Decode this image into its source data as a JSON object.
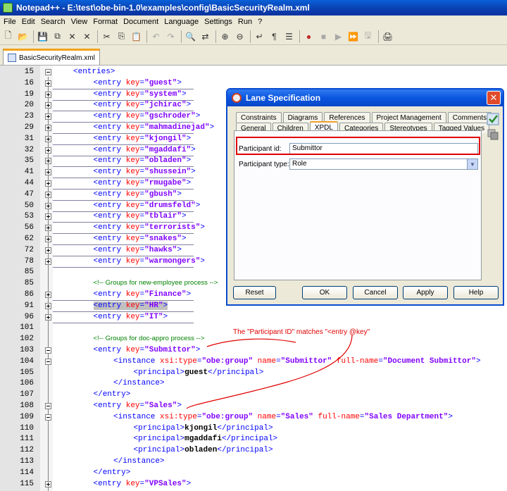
{
  "window": {
    "title": "Notepad++ - E:\\test\\obe-bin-1.0\\examples\\config\\BasicSecurityRealm.xml"
  },
  "menu": [
    "File",
    "Edit",
    "Search",
    "View",
    "Format",
    "Document",
    "Language",
    "Settings",
    "Run",
    "?"
  ],
  "toolbar": {
    "icons": [
      "new-file",
      "open-file",
      "save",
      "save-all",
      "close",
      "close-all",
      "cut",
      "copy",
      "paste",
      "undo",
      "redo",
      "find",
      "replace",
      "zoom-in",
      "zoom-out",
      "wrap",
      "show-all",
      "indent-guide",
      "record-macro",
      "stop-record",
      "play-macro",
      "run-macro-multiple",
      "save-macro",
      "print"
    ]
  },
  "tab": {
    "filename": "BasicSecurityRealm.xml"
  },
  "editor": {
    "lines": [
      {
        "n": "15",
        "kind": "open",
        "indent": 1,
        "text": "<entries>"
      },
      {
        "n": "16",
        "kind": "entry",
        "key": "guest"
      },
      {
        "n": "19",
        "kind": "entry",
        "key": "system"
      },
      {
        "n": "20",
        "kind": "entry",
        "key": "jchirac"
      },
      {
        "n": "23",
        "kind": "entry",
        "key": "gschroder"
      },
      {
        "n": "29",
        "kind": "entry",
        "key": "mahmadinejad"
      },
      {
        "n": "31",
        "kind": "entry",
        "key": "kjongil"
      },
      {
        "n": "32",
        "kind": "entry",
        "key": "mgaddafi"
      },
      {
        "n": "35",
        "kind": "entry",
        "key": "obladen"
      },
      {
        "n": "41",
        "kind": "entry",
        "key": "shussein"
      },
      {
        "n": "44",
        "kind": "entry",
        "key": "rmugabe"
      },
      {
        "n": "47",
        "kind": "entry",
        "key": "gbush"
      },
      {
        "n": "50",
        "kind": "entry",
        "key": "drumsfeld"
      },
      {
        "n": "53",
        "kind": "entry",
        "key": "tblair"
      },
      {
        "n": "56",
        "kind": "entry",
        "key": "terrorists"
      },
      {
        "n": "62",
        "kind": "entry",
        "key": "snakes"
      },
      {
        "n": "72",
        "kind": "entry",
        "key": "hawks"
      },
      {
        "n": "78",
        "kind": "entry",
        "key": "warmongers"
      },
      {
        "n": "85",
        "kind": "blank"
      },
      {
        "n": "85",
        "kind": "comment",
        "text": "<!-- Groups for new-employee process -->"
      },
      {
        "n": "86",
        "kind": "entry",
        "key": "Finance"
      },
      {
        "n": "91",
        "kind": "entry",
        "key": "HR",
        "highlight": true
      },
      {
        "n": "96",
        "kind": "entry",
        "key": "IT"
      },
      {
        "n": "101",
        "kind": "blank"
      },
      {
        "n": "102",
        "kind": "comment",
        "text": "<!-- Groups for doc-appro process -->"
      },
      {
        "n": "103",
        "kind": "entry",
        "key": "Submittor"
      },
      {
        "n": "104",
        "kind": "instance",
        "type": "obe:group",
        "name": "Submittor",
        "fullname": "Document Submittor"
      },
      {
        "n": "105",
        "kind": "principal",
        "text": "guest"
      },
      {
        "n": "106",
        "kind": "close",
        "indent": 3,
        "text": "</instance>"
      },
      {
        "n": "107",
        "kind": "close",
        "indent": 2,
        "text": "</entry>"
      },
      {
        "n": "108",
        "kind": "entry",
        "key": "Sales"
      },
      {
        "n": "109",
        "kind": "instance",
        "type": "obe:group",
        "name": "Sales",
        "fullname": "Sales Department"
      },
      {
        "n": "110",
        "kind": "principal",
        "text": "kjongil"
      },
      {
        "n": "111",
        "kind": "principal",
        "text": "mgaddafi"
      },
      {
        "n": "112",
        "kind": "principal",
        "text": "obladen"
      },
      {
        "n": "113",
        "kind": "close",
        "indent": 3,
        "text": "</instance>"
      },
      {
        "n": "114",
        "kind": "close",
        "indent": 2,
        "text": "</entry>"
      },
      {
        "n": "115",
        "kind": "entry",
        "key": "VPSales"
      }
    ]
  },
  "annotation": {
    "text": "The \"Participant ID\" matches \"<entry @key\""
  },
  "dialog": {
    "title": "Lane Specification",
    "tabs_row1": [
      "Constraints",
      "Diagrams",
      "References",
      "Project Management",
      "Comments"
    ],
    "tabs_row2": [
      "General",
      "Children",
      "XPDL",
      "Categories",
      "Stereotypes",
      "Tagged Values"
    ],
    "active_tab": "XPDL",
    "participant_id_label": "Participant id:",
    "participant_id_value": "Submittor",
    "participant_type_label": "Participant type:",
    "participant_type_value": "Role",
    "buttons": {
      "reset": "Reset",
      "ok": "OK",
      "cancel": "Cancel",
      "apply": "Apply",
      "help": "Help"
    }
  },
  "colors": {
    "tag": "#0000ff",
    "attr": "#ff0000",
    "value": "#8000ff",
    "annotation": "#e00000",
    "comment": "#008000"
  }
}
